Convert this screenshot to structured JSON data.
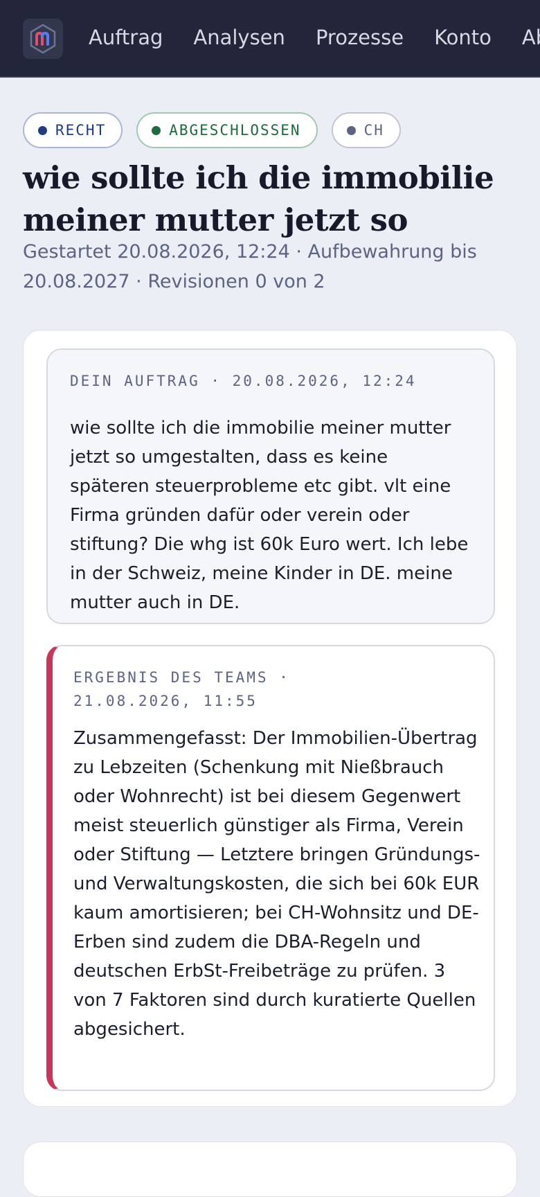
{
  "topbar": {
    "logo_alt": "m",
    "nav": [
      "Auftrag",
      "Analysen",
      "Prozesse",
      "Konto",
      "Abmelden"
    ]
  },
  "tags": {
    "area": "RECHT",
    "status": "ABGESCHLOSSEN",
    "country": "CH"
  },
  "page": {
    "title": "wie sollte ich die immobilie meiner mutter jetzt so",
    "meta": "Gestartet 20.08.2026, 12:24 · Aufbewahrung bis 20.08.2027 · Revisionen 0 von 2"
  },
  "request": {
    "label": "DEIN AUFTRAG · 20.08.2026, 12:24",
    "text": "wie sollte ich die immobilie meiner mutter jetzt so umgestalten, dass es keine späteren steuerprobleme etc gibt. vlt eine Firma gründen dafür oder verein oder stiftung? Die whg ist 60k Euro wert. Ich lebe in der Schweiz, meine Kinder in DE. meine mutter auch in DE."
  },
  "result": {
    "label": "ERGEBNIS DES TEAMS · 21.08.2026, 11:55",
    "text": "Zusammengefasst: Der Immobilien-Übertrag zu Lebzeiten (Schenkung mit Nießbrauch oder Wohnrecht) ist bei diesem Gegenwert meist steuerlich günstiger als Firma, Verein oder Stiftung — Letztere bringen Gründungs- und Verwaltungskosten, die sich bei 60k EUR kaum amortisieren; bei CH-Wohnsitz und DE-Erben sind zudem die DBA-Regeln und deutschen ErbSt-Freibeträge zu prüfen. 3 von 7 Faktoren sind durch kuratierte Quellen abgesichert."
  },
  "colors": {
    "topbar": "#23263a",
    "background": "#eceef5",
    "accent": "#c9365b",
    "status_green": "#1d6a3d",
    "area_blue": "#1d3c82"
  }
}
